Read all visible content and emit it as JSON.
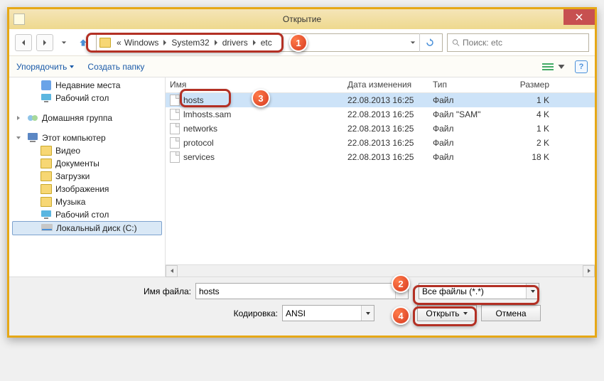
{
  "dialog": {
    "title": "Открытие"
  },
  "nav": {
    "crumbs": [
      "«",
      "Windows",
      "System32",
      "drivers",
      "etc"
    ]
  },
  "search": {
    "placeholder": "Поиск: etc"
  },
  "toolbar": {
    "organize": "Упорядочить",
    "new_folder": "Создать папку"
  },
  "tree": {
    "recent": "Недавние места",
    "desktop1": "Рабочий стол",
    "homegroup": "Домашняя группа",
    "this_pc": "Этот компьютер",
    "videos": "Видео",
    "documents": "Документы",
    "downloads": "Загрузки",
    "pictures": "Изображения",
    "music": "Музыка",
    "desktop2": "Рабочий стол",
    "local_disk": "Локальный диск (C:)"
  },
  "columns": {
    "name": "Имя",
    "date": "Дата изменения",
    "type": "Тип",
    "size": "Размер"
  },
  "files": [
    {
      "name": "hosts",
      "date": "22.08.2013 16:25",
      "type": "Файл",
      "size": "1 K",
      "selected": true
    },
    {
      "name": "lmhosts.sam",
      "date": "22.08.2013 16:25",
      "type": "Файл \"SAM\"",
      "size": "4 K",
      "selected": false
    },
    {
      "name": "networks",
      "date": "22.08.2013 16:25",
      "type": "Файл",
      "size": "1 K",
      "selected": false
    },
    {
      "name": "protocol",
      "date": "22.08.2013 16:25",
      "type": "Файл",
      "size": "2 K",
      "selected": false
    },
    {
      "name": "services",
      "date": "22.08.2013 16:25",
      "type": "Файл",
      "size": "18 K",
      "selected": false
    }
  ],
  "form": {
    "filename_label": "Имя файла:",
    "filename_value": "hosts",
    "filetype_value": "Все файлы  (*.*)",
    "encoding_label": "Кодировка:",
    "encoding_value": "ANSI",
    "open": "Открыть",
    "cancel": "Отмена"
  },
  "badges": {
    "b1": "1",
    "b2": "2",
    "b3": "3",
    "b4": "4"
  }
}
